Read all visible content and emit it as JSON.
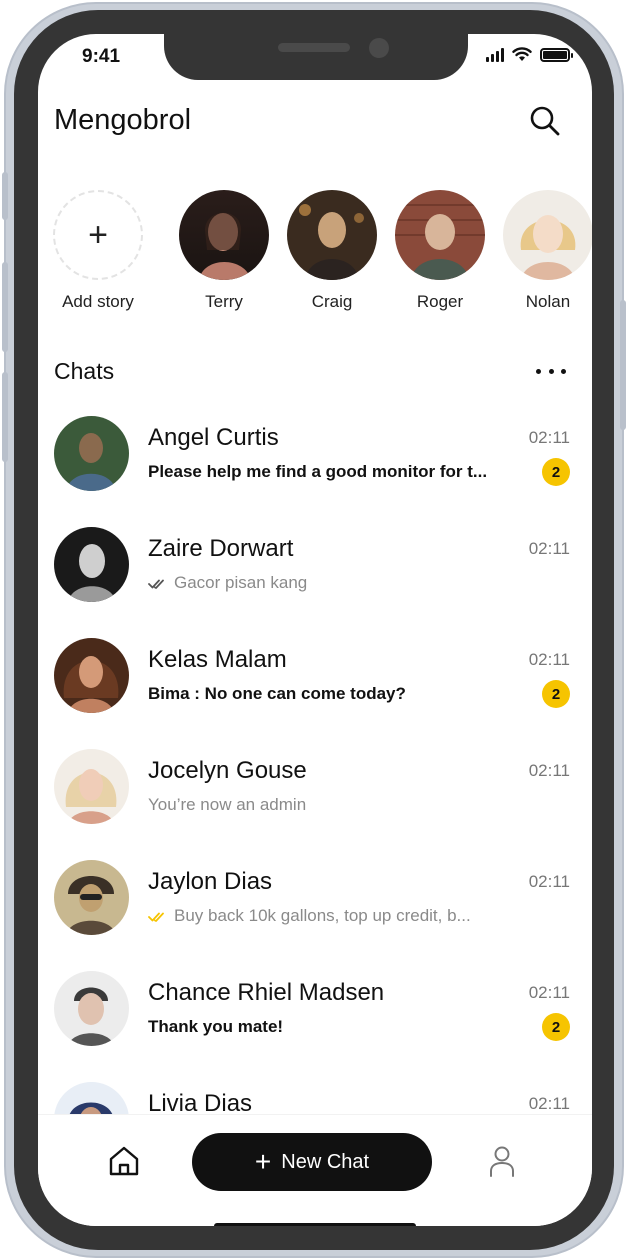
{
  "status_bar": {
    "time": "9:41"
  },
  "header": {
    "title": "Mengobrol",
    "search_icon": "search-icon"
  },
  "stories": {
    "add_label": "Add story",
    "items": [
      {
        "name": "Terry",
        "colors": [
          "#2a1d1a",
          "#b97a6a"
        ]
      },
      {
        "name": "Craig",
        "colors": [
          "#3a2b1f",
          "#c8a27a"
        ]
      },
      {
        "name": "Roger",
        "colors": [
          "#7a3b2e",
          "#d8b59a"
        ]
      },
      {
        "name": "Nolan",
        "colors": [
          "#e8c88a",
          "#f4dcc8"
        ]
      }
    ]
  },
  "chats": {
    "title": "Chats",
    "more_icon": "more-horizontal-icon",
    "items": [
      {
        "name": "Angel Curtis",
        "time": "02:11",
        "message": "Please help me find a good monitor for t...",
        "state": "unread",
        "badge": "2",
        "colors": [
          "#3b5a3a",
          "#8a6a4e"
        ]
      },
      {
        "name": "Zaire Dorwart",
        "time": "02:11",
        "message": "Gacor pisan kang",
        "state": "read-gray",
        "badge": "",
        "colors": [
          "#1a1a1a",
          "#cfcfcf"
        ]
      },
      {
        "name": "Kelas Malam",
        "time": "02:11",
        "message": "Bima : No one can come today?",
        "state": "unread",
        "badge": "2",
        "colors": [
          "#4a2a1a",
          "#d49a78"
        ]
      },
      {
        "name": "Jocelyn Gouse",
        "time": "02:11",
        "message": "You’re now an admin",
        "state": "read",
        "badge": "",
        "colors": [
          "#e8d2a8",
          "#d8a08a"
        ]
      },
      {
        "name": "Jaylon Dias",
        "time": "02:11",
        "message": "Buy back 10k gallons, top up credit, b...",
        "state": "read-yellow",
        "badge": "",
        "colors": [
          "#3a3026",
          "#c0a070"
        ]
      },
      {
        "name": "Chance Rhiel Madsen",
        "time": "02:11",
        "message": "Thank you mate!",
        "state": "unread",
        "badge": "2",
        "colors": [
          "#3a3a3a",
          "#e0c2b0"
        ]
      },
      {
        "name": "Livia Dias",
        "time": "02:11",
        "message": "",
        "state": "read",
        "badge": "",
        "colors": [
          "#2a3a6a",
          "#c89a80"
        ]
      }
    ]
  },
  "bottom_nav": {
    "home_icon": "home-icon",
    "new_chat_label": "New Chat",
    "profile_icon": "user-icon"
  },
  "colors": {
    "accent": "#f6c400",
    "dark": "#111111",
    "frame": "#353535"
  }
}
